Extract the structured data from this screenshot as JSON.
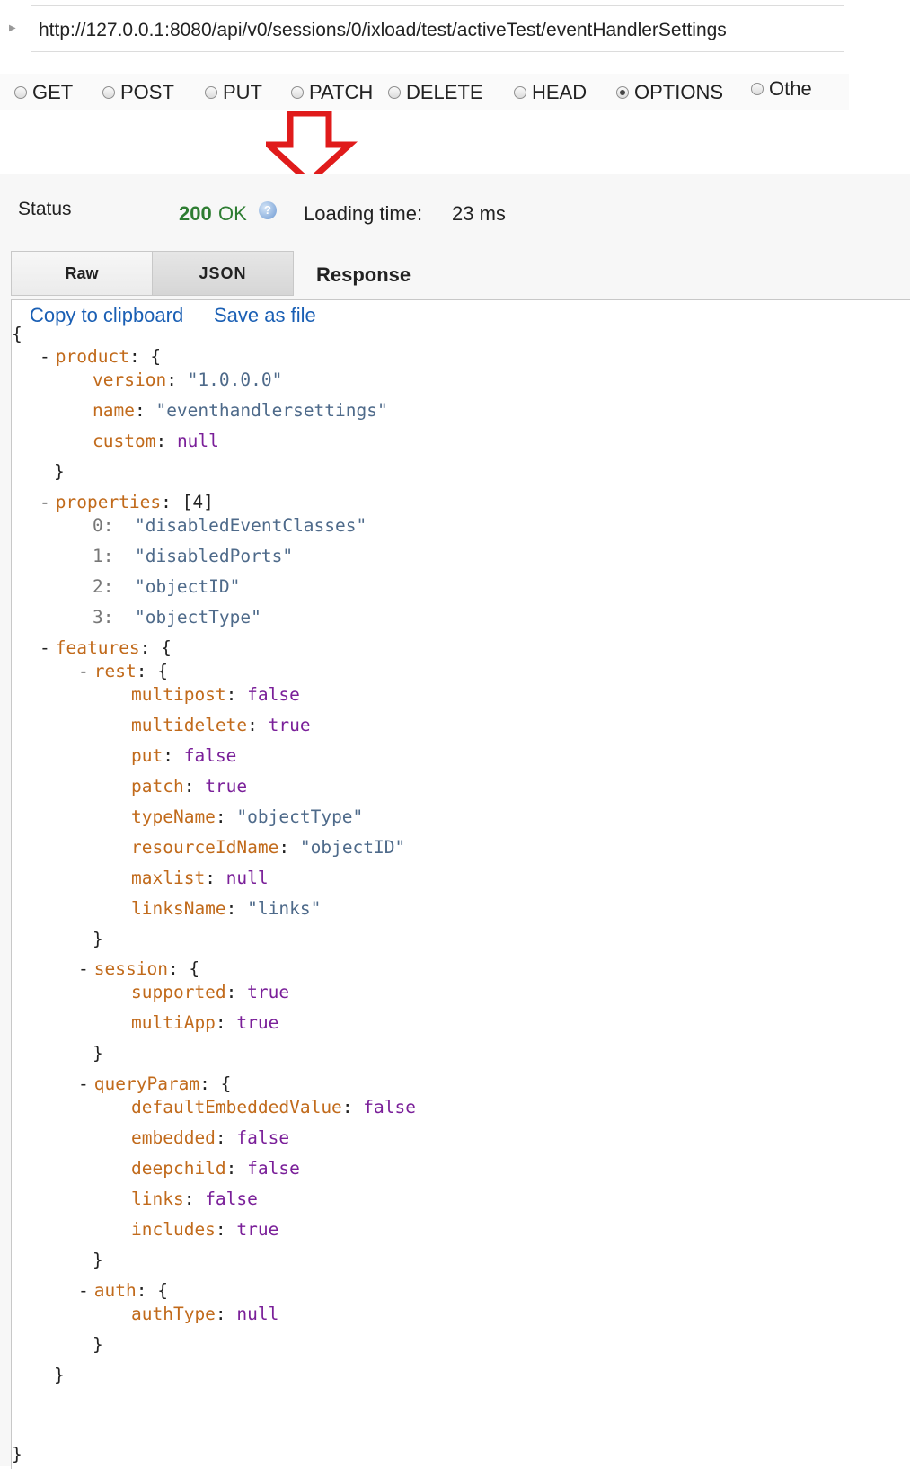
{
  "request": {
    "url": "http://127.0.0.1:8080/api/v0/sessions/0/ixload/test/activeTest/eventHandlerSettings",
    "methods": [
      "GET",
      "POST",
      "PUT",
      "PATCH",
      "DELETE",
      "HEAD",
      "OPTIONS",
      "Othe"
    ],
    "selected_method": "OPTIONS"
  },
  "status": {
    "label": "Status",
    "code": "200",
    "text": "OK",
    "loading_label": "Loading time:",
    "loading_value": "23 ms"
  },
  "tabs": {
    "raw": "Raw",
    "json": "JSON",
    "response": "Response"
  },
  "actions": {
    "copy": "Copy to clipboard",
    "save": "Save as file"
  },
  "json_tree": {
    "product": {
      "version": "\"1.0.0.0\"",
      "name": "\"eventhandlersettings\"",
      "custom": "null"
    },
    "properties": {
      "count": "[4]",
      "items": [
        "\"disabledEventClasses\"",
        "\"disabledPorts\"",
        "\"objectID\"",
        "\"objectType\""
      ]
    },
    "features": {
      "rest": {
        "multipost": "false",
        "multidelete": "true",
        "put": "false",
        "patch": "true",
        "typeName": "\"objectType\"",
        "resourceIdName": "\"objectID\"",
        "maxlist": "null",
        "linksName": "\"links\""
      },
      "session": {
        "supported": "true",
        "multiApp": "true"
      },
      "queryParam": {
        "defaultEmbeddedValue": "false",
        "embedded": "false",
        "deepchild": "false",
        "links": "false",
        "includes": "true"
      },
      "auth": {
        "authType": "null"
      }
    }
  },
  "colors": {
    "key": "#c16a1b",
    "string": "#4e6a8a",
    "literal": "#7a1f99",
    "status_ok": "#2e7d32",
    "link": "#1a5fb4",
    "arrow": "#e01b1b"
  }
}
